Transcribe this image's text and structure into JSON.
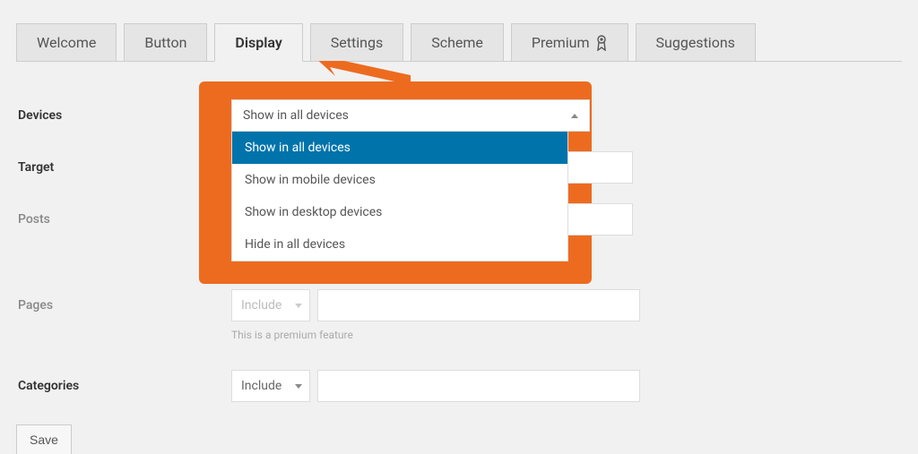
{
  "tabs": [
    {
      "id": "welcome",
      "label": "Welcome"
    },
    {
      "id": "button",
      "label": "Button"
    },
    {
      "id": "display",
      "label": "Display"
    },
    {
      "id": "settings",
      "label": "Settings"
    },
    {
      "id": "scheme",
      "label": "Scheme"
    },
    {
      "id": "premium",
      "label": "Premium"
    },
    {
      "id": "suggestions",
      "label": "Suggestions"
    }
  ],
  "active_tab": "display",
  "form": {
    "devices": {
      "label": "Devices",
      "selected": "Show in all devices",
      "options": [
        "Show in all devices",
        "Show in mobile devices",
        "Show in desktop devices",
        "Hide in all devices"
      ]
    },
    "target": {
      "label": "Target"
    },
    "posts": {
      "label": "Posts"
    },
    "pages": {
      "label": "Pages",
      "include_label": "Include",
      "hint": "This is a premium feature"
    },
    "categories": {
      "label": "Categories",
      "include_label": "Include"
    }
  },
  "save_label": "Save",
  "callout": {
    "color": "#ed6b1f"
  }
}
